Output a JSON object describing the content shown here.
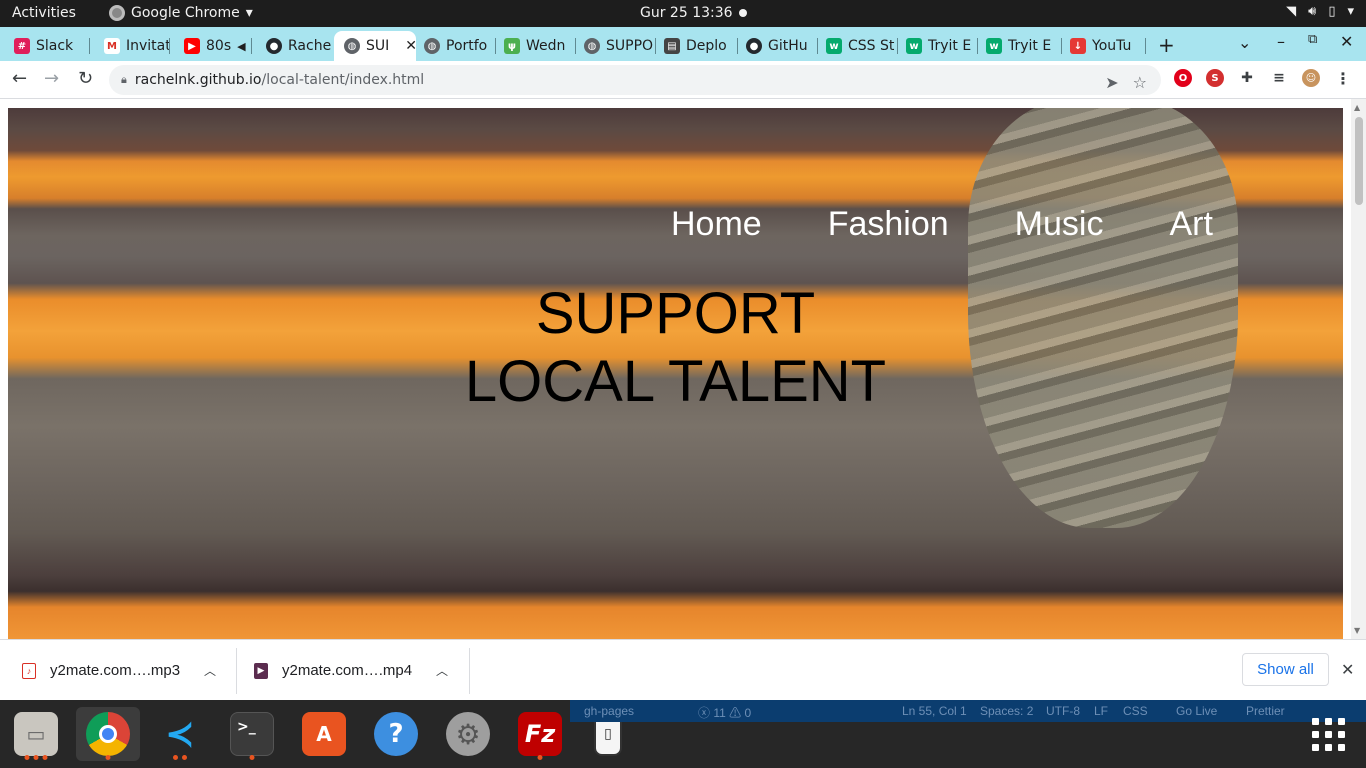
{
  "system": {
    "activities": "Activities",
    "app_name": "Google Chrome",
    "clock": "Gur 25  13:36"
  },
  "tabs": [
    {
      "label": "Slack",
      "icon": "slack-icon",
      "color": "#e01e5a"
    },
    {
      "label": "Invitat",
      "icon": "gmail-icon",
      "color": "#d93025"
    },
    {
      "label": "80s",
      "icon": "youtube-icon",
      "color": "#ff0000"
    },
    {
      "label": "Rache",
      "icon": "github-icon",
      "color": "#24292e"
    },
    {
      "label": "SUI",
      "icon": "globe-icon",
      "color": "#5f6368"
    },
    {
      "label": "Portfo",
      "icon": "globe-icon",
      "color": "#5f6368"
    },
    {
      "label": "Wedn",
      "icon": "palm-icon",
      "color": "#4caf50"
    },
    {
      "label": "SUPPO",
      "icon": "globe-icon",
      "color": "#5f6368"
    },
    {
      "label": "Deplo",
      "icon": "deploy-icon",
      "color": "#444444"
    },
    {
      "label": "GitHu",
      "icon": "github-icon",
      "color": "#24292e"
    },
    {
      "label": "CSS St",
      "icon": "w3schools-icon",
      "color": "#04aa6d"
    },
    {
      "label": "Tryit E",
      "icon": "w3schools-icon",
      "color": "#04aa6d"
    },
    {
      "label": "Tryit E",
      "icon": "w3schools-icon",
      "color": "#04aa6d"
    },
    {
      "label": "YouTu",
      "icon": "youtube-download-icon",
      "color": "#e53935"
    }
  ],
  "address": {
    "host": "rachelnk.github.io",
    "path": "/local-talent/index.html"
  },
  "page": {
    "nav": [
      "Home",
      "Fashion",
      "Music",
      "Art"
    ],
    "headline_line1": "SUPPORT",
    "headline_line2": "LOCAL TALENT"
  },
  "downloads": {
    "items": [
      {
        "name": "y2mate.com….mp3",
        "icon": "audio-file-icon"
      },
      {
        "name": "y2mate.com….mp4",
        "icon": "video-file-icon"
      }
    ],
    "show_all": "Show all"
  },
  "vscode_status": {
    "branch": "gh-pages",
    "problems": "ⓧ 11 ⚠ 0",
    "position": "Ln 55, Col 1",
    "spaces": "Spaces: 2",
    "encoding": "UTF-8",
    "eol": "LF",
    "language": "CSS",
    "golive": "Go Live",
    "prettier": "Prettier"
  },
  "dock": [
    "files-icon",
    "chrome-icon",
    "vscode-icon",
    "terminal-icon",
    "software-icon",
    "help-icon",
    "settings-icon",
    "filezilla-icon",
    "media-player-icon"
  ],
  "colors": {
    "tabstrip": "#a8e4ef",
    "accent_link": "#1a73e8",
    "dock_indicator": "#e95420"
  }
}
